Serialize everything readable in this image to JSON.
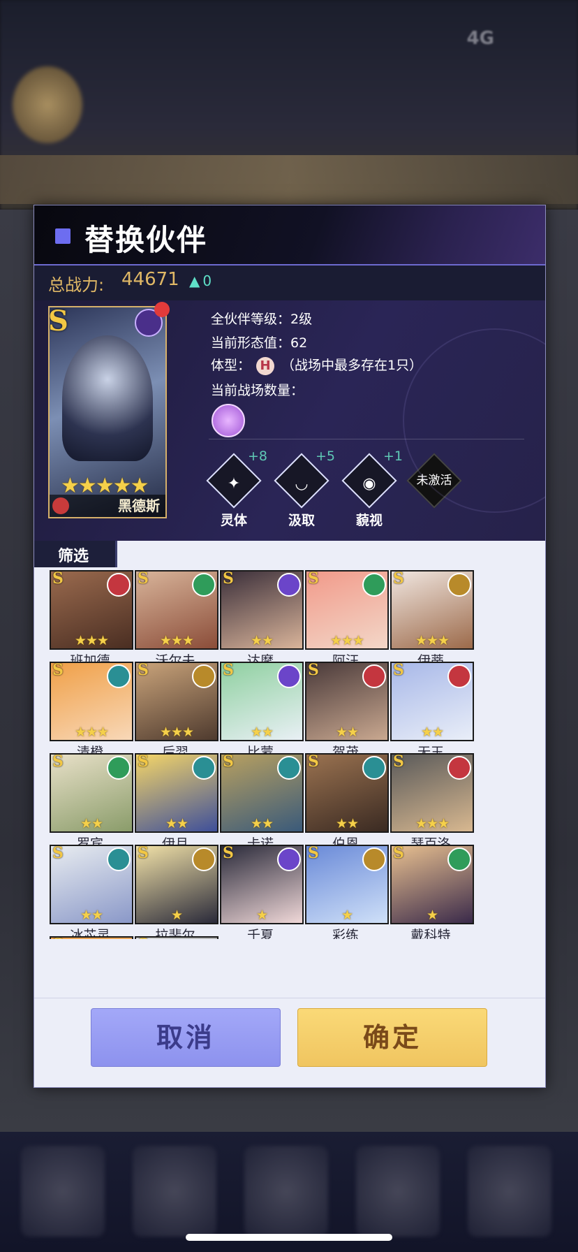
{
  "status": {
    "network": "4G"
  },
  "dialog": {
    "title": "替换伙伴",
    "total_power_label": "总战力:",
    "total_power_value": "44671",
    "power_change": "0",
    "current_hero": {
      "rank": "S",
      "name": "黑德斯",
      "stars": "★★★★★"
    },
    "info": {
      "level": "全伙伴等级：2级",
      "form_value": "当前形态值：62",
      "body_type_label": "体型：",
      "body_type_badge": "H",
      "body_type_note": "（战场中最多存在1只）",
      "battle_count_label": "当前战场数量："
    },
    "skills": [
      {
        "label": "灵体",
        "plus": "+8",
        "glyph": "✦"
      },
      {
        "label": "汲取",
        "plus": "+5",
        "glyph": "◡"
      },
      {
        "label": "藐视",
        "plus": "+1",
        "glyph": "◉"
      },
      {
        "label": "",
        "plus": "",
        "glyph": "未激活"
      }
    ],
    "filter_label": "筛选",
    "heroes": [
      {
        "name": "班加德",
        "stars": "★★★",
        "faction": "#c4363f",
        "art": [
          "#9a6a4e",
          "#4a2e22"
        ]
      },
      {
        "name": "沃尔夫",
        "stars": "★★★",
        "faction": "#2f9c5a",
        "art": [
          "#d8b49a",
          "#8b4d39"
        ]
      },
      {
        "name": "达摩",
        "stars": "★★",
        "faction": "#6b45c9",
        "art": [
          "#3b2f3a",
          "#d9b49a"
        ]
      },
      {
        "name": "阿汪",
        "stars": "★★★",
        "faction": "#2f9c5a",
        "art": [
          "#f19a8a",
          "#f3d7c8"
        ]
      },
      {
        "name": "伊蒂",
        "stars": "★★★",
        "faction": "#b88a2a",
        "art": [
          "#f0e6e0",
          "#9c6a4a"
        ]
      },
      {
        "name": "清橙",
        "stars": "★★★",
        "faction": "#2a8f94",
        "art": [
          "#f0a048",
          "#f8d8b8"
        ]
      },
      {
        "name": "后羿",
        "stars": "★★★",
        "faction": "#b88a2a",
        "art": [
          "#c9a37a",
          "#4e3a2e"
        ]
      },
      {
        "name": "比蒙",
        "stars": "★★",
        "faction": "#6b45c9",
        "art": [
          "#8fd0a0",
          "#e9f0f5"
        ]
      },
      {
        "name": "贺茂",
        "stars": "★★",
        "faction": "#c4363f",
        "art": [
          "#4a3a3a",
          "#c9a890"
        ]
      },
      {
        "name": "无玉",
        "stars": "★★",
        "faction": "#c4363f",
        "art": [
          "#a8b8e8",
          "#e9eef8"
        ]
      },
      {
        "name": "罗宾",
        "stars": "★★",
        "faction": "#2f9c5a",
        "art": [
          "#e8e0c8",
          "#8a9c6a"
        ]
      },
      {
        "name": "伊月",
        "stars": "★★",
        "faction": "#2a8f94",
        "art": [
          "#f5d668",
          "#3e4f9a"
        ]
      },
      {
        "name": "卡诺",
        "stars": "★★",
        "faction": "#2a8f94",
        "art": [
          "#b8a060",
          "#3a5a7a"
        ]
      },
      {
        "name": "伯恩",
        "stars": "★★",
        "faction": "#2a8f94",
        "art": [
          "#9a7250",
          "#3a2a22"
        ]
      },
      {
        "name": "瑟百洛",
        "stars": "★★★",
        "faction": "#c4363f",
        "art": [
          "#5a5a5a",
          "#d8b890"
        ]
      },
      {
        "name": "冰芯灵",
        "stars": "★★",
        "faction": "#2a8f94",
        "art": [
          "#e8ecf0",
          "#8a98c8"
        ]
      },
      {
        "name": "拉斐尔",
        "stars": "★",
        "faction": "#b88a2a",
        "art": [
          "#f2e2a8",
          "#2a2a3a"
        ]
      },
      {
        "name": "千夏",
        "stars": "★",
        "faction": "#6b45c9",
        "art": [
          "#2a2a3a",
          "#f0d8d8"
        ]
      },
      {
        "name": "彩练",
        "stars": "★",
        "faction": "#b88a2a",
        "art": [
          "#6a8ad8",
          "#cfe0f8"
        ]
      },
      {
        "name": "戴科特",
        "stars": "★",
        "faction": "#2f9c5a",
        "art": [
          "#e8c090",
          "#3a2a4a"
        ]
      },
      {
        "name": "",
        "stars": "",
        "faction": "#2a8f94",
        "art": [
          "#f0a048",
          "#d8b080"
        ]
      },
      {
        "name": "",
        "stars": "",
        "faction": "#2a8f94",
        "art": [
          "#d8d8d8",
          "#4a4a4a"
        ]
      }
    ],
    "buttons": {
      "cancel": "取消",
      "confirm": "确定"
    }
  }
}
